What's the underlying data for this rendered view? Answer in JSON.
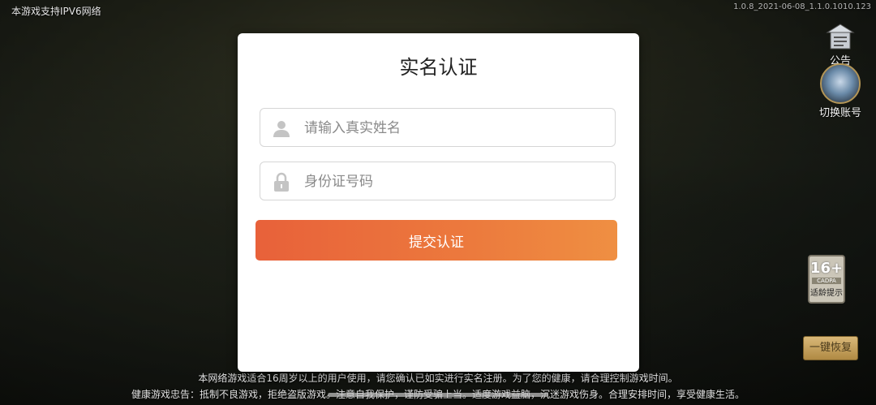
{
  "topbar": {
    "network_notice": "本游戏支持IPV6网络",
    "version": "1.0.8_2021-06-08_1.1.0.1010.123"
  },
  "side": {
    "notice_label": "公告",
    "switch_account_label": "切换账号",
    "age_rating": {
      "number": "16+",
      "org": "CADPA",
      "tip": "适龄提示"
    },
    "restore_label": "一键恢复"
  },
  "dialog": {
    "title": "实名认证",
    "name_placeholder": "请输入真实姓名",
    "id_placeholder": "身份证号码",
    "submit_label": "提交认证"
  },
  "footer": {
    "line1": "本网络游戏适合16周岁以上的用户使用，请您确认已如实进行实名注册。为了您的健康，请合理控制游戏时间。",
    "line2": "健康游戏忠告：抵制不良游戏，拒绝盗版游戏。注意自我保护，谨防受骗上当。适度游戏益脑，沉迷游戏伤身。合理安排时间，享受健康生活。"
  },
  "colors": {
    "accent_start": "#e8613a",
    "accent_end": "#ef8f42"
  }
}
